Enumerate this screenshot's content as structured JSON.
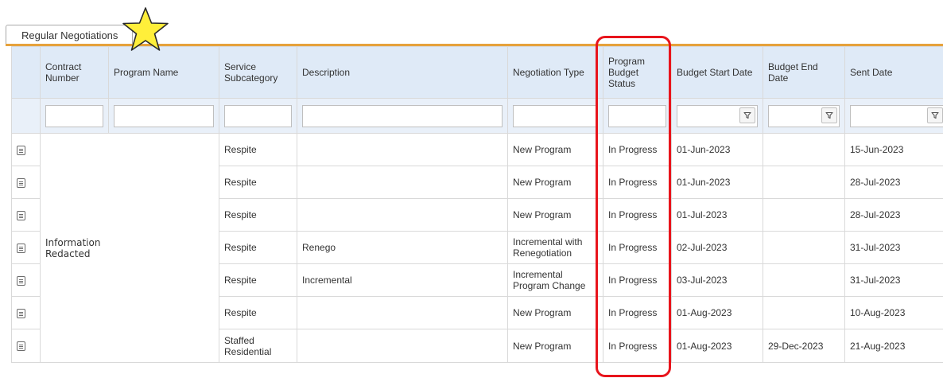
{
  "tab": {
    "label": "Regular Negotiations",
    "star": "star-icon",
    "accent": "#e6a23c"
  },
  "columns": [
    {
      "key": "icon",
      "label": ""
    },
    {
      "key": "contract_number",
      "label": "Contract Number"
    },
    {
      "key": "program_name",
      "label": "Program Name"
    },
    {
      "key": "service_subcategory",
      "label": "Service Subcategory"
    },
    {
      "key": "description",
      "label": "Description"
    },
    {
      "key": "negotiation_type",
      "label": "Negotiation Type"
    },
    {
      "key": "program_budget_status",
      "label": "Program Budget Status"
    },
    {
      "key": "budget_start_date",
      "label": "Budget Start Date"
    },
    {
      "key": "budget_end_date",
      "label": "Budget End Date"
    },
    {
      "key": "sent_date",
      "label": "Sent Date"
    }
  ],
  "filters": {
    "contract_number": "",
    "program_name": "",
    "service_subcategory": "",
    "description": "",
    "negotiation_type": "",
    "program_budget_status": "",
    "budget_start_date": "",
    "budget_end_date": "",
    "sent_date": "",
    "filter_icon": "filter-icon"
  },
  "redacted_text": "Information\nRedacted",
  "rows": [
    {
      "service_subcategory": "Respite",
      "description": "",
      "negotiation_type": "New Program",
      "program_budget_status": "In Progress",
      "budget_start_date": "01-Jun-2023",
      "budget_end_date": "",
      "sent_date": "15-Jun-2023"
    },
    {
      "service_subcategory": "Respite",
      "description": "",
      "negotiation_type": "New Program",
      "program_budget_status": "In Progress",
      "budget_start_date": "01-Jun-2023",
      "budget_end_date": "",
      "sent_date": "28-Jul-2023"
    },
    {
      "service_subcategory": "Respite",
      "description": "",
      "negotiation_type": "New Program",
      "program_budget_status": "In Progress",
      "budget_start_date": "01-Jul-2023",
      "budget_end_date": "",
      "sent_date": "28-Jul-2023"
    },
    {
      "service_subcategory": "Respite",
      "description": "Renego",
      "negotiation_type": "Incremental with Renegotiation",
      "program_budget_status": "In Progress",
      "budget_start_date": "02-Jul-2023",
      "budget_end_date": "",
      "sent_date": "31-Jul-2023"
    },
    {
      "service_subcategory": "Respite",
      "description": "Incremental",
      "negotiation_type": "Incremental Program Change",
      "program_budget_status": "In Progress",
      "budget_start_date": "03-Jul-2023",
      "budget_end_date": "",
      "sent_date": "31-Jul-2023"
    },
    {
      "service_subcategory": "Respite",
      "description": "",
      "negotiation_type": "New Program",
      "program_budget_status": "In Progress",
      "budget_start_date": "01-Aug-2023",
      "budget_end_date": "",
      "sent_date": "10-Aug-2023"
    },
    {
      "service_subcategory": "Staffed Residential",
      "description": "",
      "negotiation_type": "New Program",
      "program_budget_status": "In Progress",
      "budget_start_date": "01-Aug-2023",
      "budget_end_date": "29-Dec-2023",
      "sent_date": "21-Aug-2023"
    }
  ],
  "colors": {
    "header_bg": "#dfeaf7",
    "filter_bg": "#e9f0f9",
    "callout": "#e8141c",
    "star": "#ffef3a"
  }
}
